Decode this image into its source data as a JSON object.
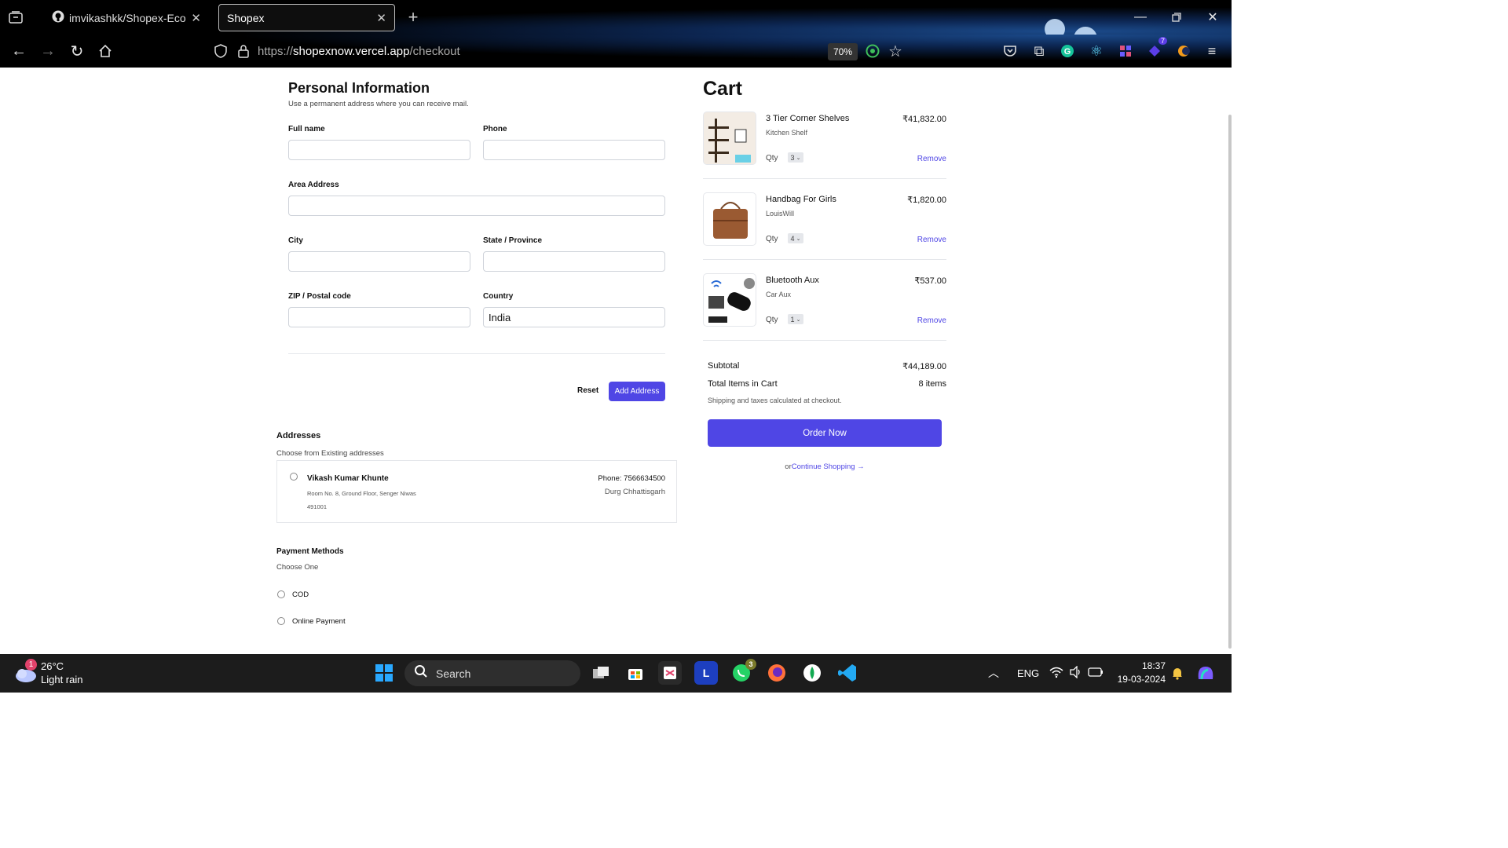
{
  "browser": {
    "tabs": [
      {
        "title": "imvikashkk/Shopex-Ecommerce"
      },
      {
        "title": "Shopex"
      }
    ],
    "url": {
      "prefix": "https://",
      "host": "shopexnow.vercel.app",
      "path": "/checkout"
    },
    "zoom": "70%"
  },
  "form": {
    "title": "Personal Information",
    "subtitle": "Use a permanent address where you can receive mail.",
    "fields": {
      "full_name": {
        "label": "Full name",
        "value": ""
      },
      "phone": {
        "label": "Phone",
        "value": ""
      },
      "area": {
        "label": "Area Address",
        "value": ""
      },
      "city": {
        "label": "City",
        "value": ""
      },
      "state": {
        "label": "State / Province",
        "value": ""
      },
      "zip": {
        "label": "ZIP / Postal code",
        "value": ""
      },
      "country": {
        "label": "Country",
        "value": "India"
      }
    },
    "reset_label": "Reset",
    "add_address_label": "Add Address"
  },
  "addresses": {
    "title": "Addresses",
    "subtitle": "Choose from Existing addresses",
    "items": [
      {
        "name": "Vikash Kumar Khunte",
        "street": "Room No. 8, Ground Floor, Senger Niwas",
        "pin": "491001",
        "phone": "Phone: 7566634500",
        "city": "Durg Chhattisgarh"
      }
    ]
  },
  "payment": {
    "title": "Payment Methods",
    "subtitle": "Choose One",
    "options": [
      "COD",
      "Online Payment"
    ]
  },
  "cart": {
    "title": "Cart",
    "items": [
      {
        "name": "3 Tier Corner Shelves",
        "brand": "Kitchen Shelf",
        "price": "₹41,832.00",
        "qty_label": "Qty",
        "qty": "3",
        "remove": "Remove"
      },
      {
        "name": "Handbag For Girls",
        "brand": "LouisWill",
        "price": "₹1,820.00",
        "qty_label": "Qty",
        "qty": "4",
        "remove": "Remove"
      },
      {
        "name": "Bluetooth Aux",
        "brand": "Car Aux",
        "price": "₹537.00",
        "qty_label": "Qty",
        "qty": "1",
        "remove": "Remove"
      }
    ],
    "subtotal_label": "Subtotal",
    "subtotal": "₹44,189.00",
    "total_items_label": "Total Items in Cart",
    "total_items": "8 items",
    "shipping_note": "Shipping and taxes calculated at checkout.",
    "order_button": "Order Now",
    "continue_prefix": "or",
    "continue_link": "Continue Shopping →"
  },
  "taskbar": {
    "weather_temp": "26°C",
    "weather_desc": "Light rain",
    "weather_badge": "1",
    "search_label": "Search",
    "whatsapp_badge": "3",
    "language": "ENG",
    "time": "18:37",
    "date": "19-03-2024",
    "ext_badge": "7"
  },
  "colors": {
    "accent": "#4f46e5",
    "chrome_bg": "#000000",
    "taskbar_bg": "#1c1c1c"
  }
}
